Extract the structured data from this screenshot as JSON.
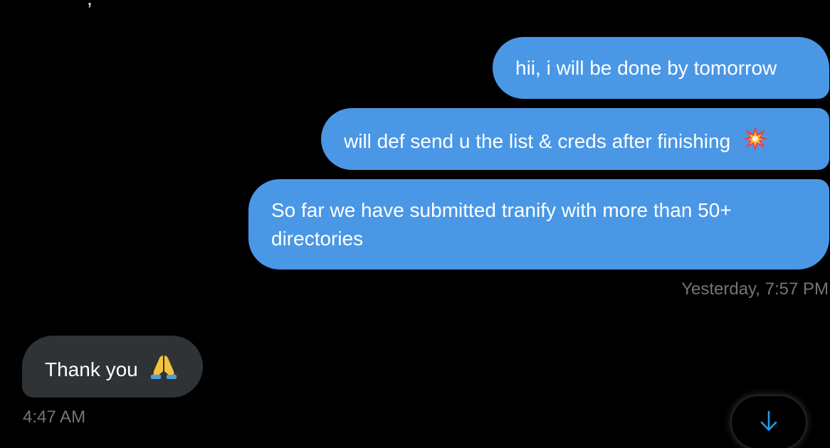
{
  "conversation": {
    "outgoing": [
      {
        "text": "hii, i will be done by tomorrow"
      },
      {
        "text": "will def send u the list & creds after finishing",
        "emoji": "collision"
      },
      {
        "text": "So far we have submitted tranify with more than 50+ directories"
      }
    ],
    "outgoing_timestamp": "Yesterday, 7:57 PM",
    "incoming": [
      {
        "text": "Thank you",
        "emoji": "folded-hands"
      }
    ],
    "incoming_timestamp": "4:47 AM"
  },
  "scroll_button": {
    "icon": "arrow-down-icon"
  },
  "colors": {
    "background": "#000000",
    "outgoing_bubble": "#4a97e6",
    "incoming_bubble": "#2f3336",
    "timestamp": "#71767b",
    "accent": "#1d9bf0"
  }
}
